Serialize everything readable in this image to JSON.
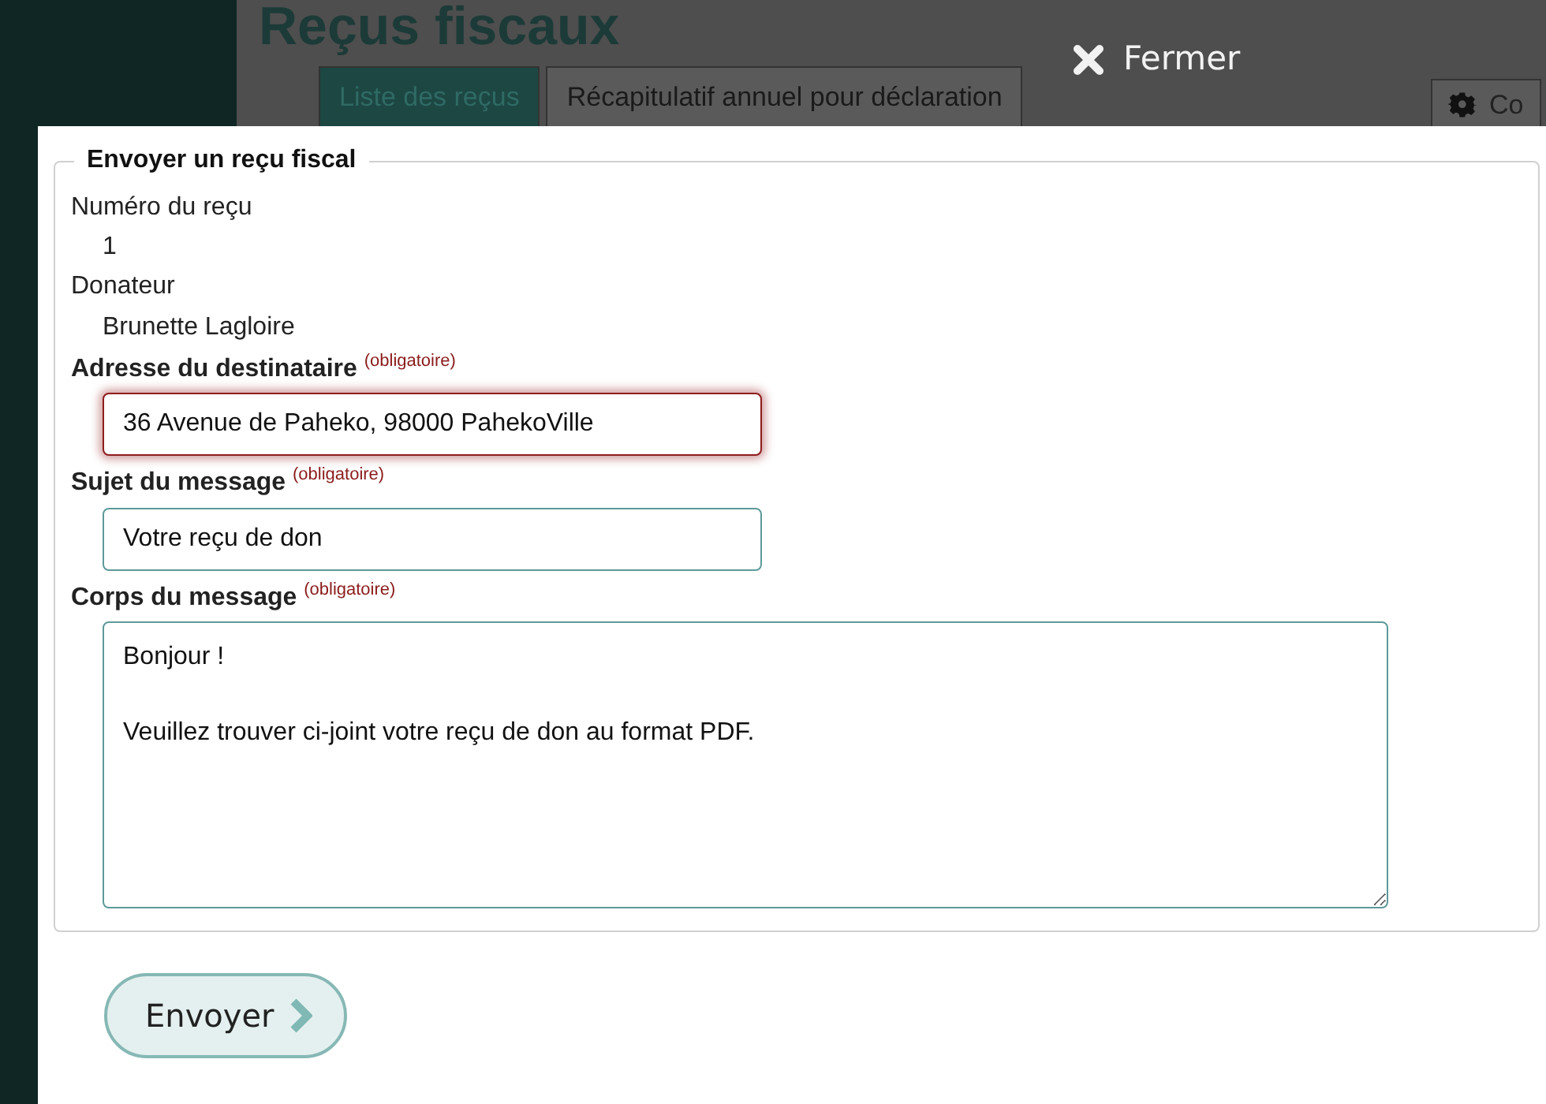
{
  "background_page": {
    "title": "Reçus fiscaux",
    "tabs": [
      {
        "label": "Liste des reçus",
        "selected": true
      },
      {
        "label": "Récapitulatif annuel pour déclaration",
        "selected": false
      }
    ],
    "toolbar_button": "Co"
  },
  "close_link": "Fermer",
  "form": {
    "legend": "Envoyer un reçu fiscal",
    "fields": [
      {
        "kind": "static",
        "label": "Numéro du reçu",
        "value": "1"
      },
      {
        "kind": "static",
        "label": "Donateur",
        "value": "Brunette Lagloire"
      },
      {
        "kind": "input",
        "label": "Adresse du destinataire",
        "note": "(obligatoire)",
        "value": "36 Avenue de Paheko, 98000 PahekoVille",
        "invalid": true
      },
      {
        "kind": "input",
        "label": "Sujet du message",
        "note": "(obligatoire)",
        "value": "Votre reçu de don",
        "invalid": false
      },
      {
        "kind": "textarea",
        "label": "Corps du message",
        "note": "(obligatoire)",
        "value": "Bonjour !\n\nVeuillez trouver ci-joint votre reçu de don au format PDF.",
        "invalid": false
      }
    ],
    "submit": "Envoyer"
  }
}
